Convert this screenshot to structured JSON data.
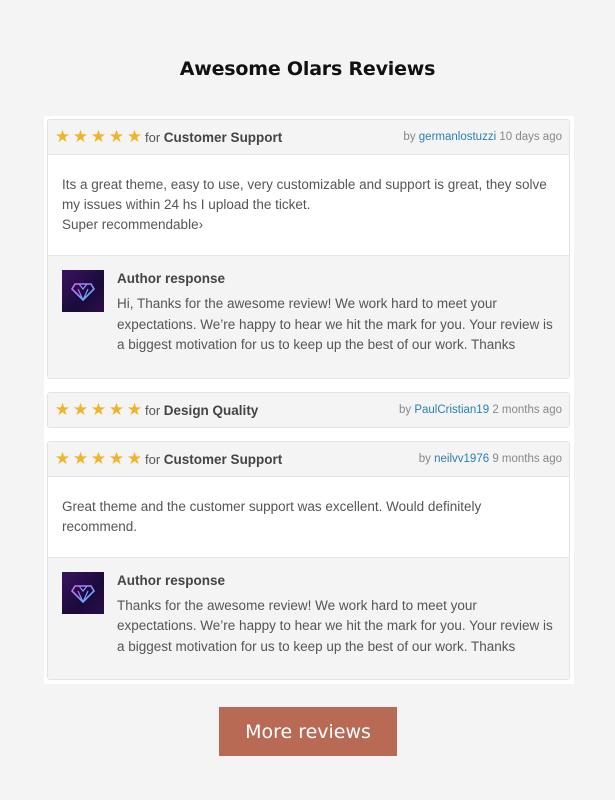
{
  "heading": "Awesome Olars Reviews",
  "colors": {
    "star": "#f0b429",
    "author_link": "#2a7fb7",
    "button": "#b86a54",
    "background": "#f4f4f4"
  },
  "reviews": [
    {
      "rating": 5,
      "stars": [
        "★",
        "★",
        "★",
        "★",
        "★"
      ],
      "for_label": "for",
      "category": "Customer Support",
      "by_label": "by",
      "author": "germanlostuzzi",
      "time": "10 days ago",
      "body": [
        "Its a great theme, easy to use, very customizable and support is great, they solve my issues within 24 hs I upload the ticket.",
        "Super recommendable›"
      ],
      "response": {
        "title": "Author response",
        "avatar_icon": "diamond-logo-icon",
        "text": "Hi, Thanks for the awesome review! We work hard to meet your expectations. We’re happy to hear we hit the mark for you. Your review is a biggest motivation for us to keep up the best of our work. Thanks"
      }
    },
    {
      "rating": 5,
      "stars": [
        "★",
        "★",
        "★",
        "★",
        "★"
      ],
      "for_label": "for",
      "category": "Design Quality",
      "by_label": "by",
      "author": "PaulCristian19",
      "time": "2 months ago"
    },
    {
      "rating": 5,
      "stars": [
        "★",
        "★",
        "★",
        "★",
        "★"
      ],
      "for_label": "for",
      "category": "Customer Support",
      "by_label": "by",
      "author": "neilvv1976",
      "time": "9 months ago",
      "body": [
        "Great theme and the customer support was excellent. Would definitely recommend."
      ],
      "response": {
        "title": "Author response",
        "avatar_icon": "diamond-logo-icon",
        "text": "Thanks for the awesome review! We work hard to meet your expectations. We’re happy to hear we hit the mark for you. Your review is a biggest motivation for us to keep up the best of our work. Thanks"
      }
    }
  ],
  "more_button": "More reviews"
}
